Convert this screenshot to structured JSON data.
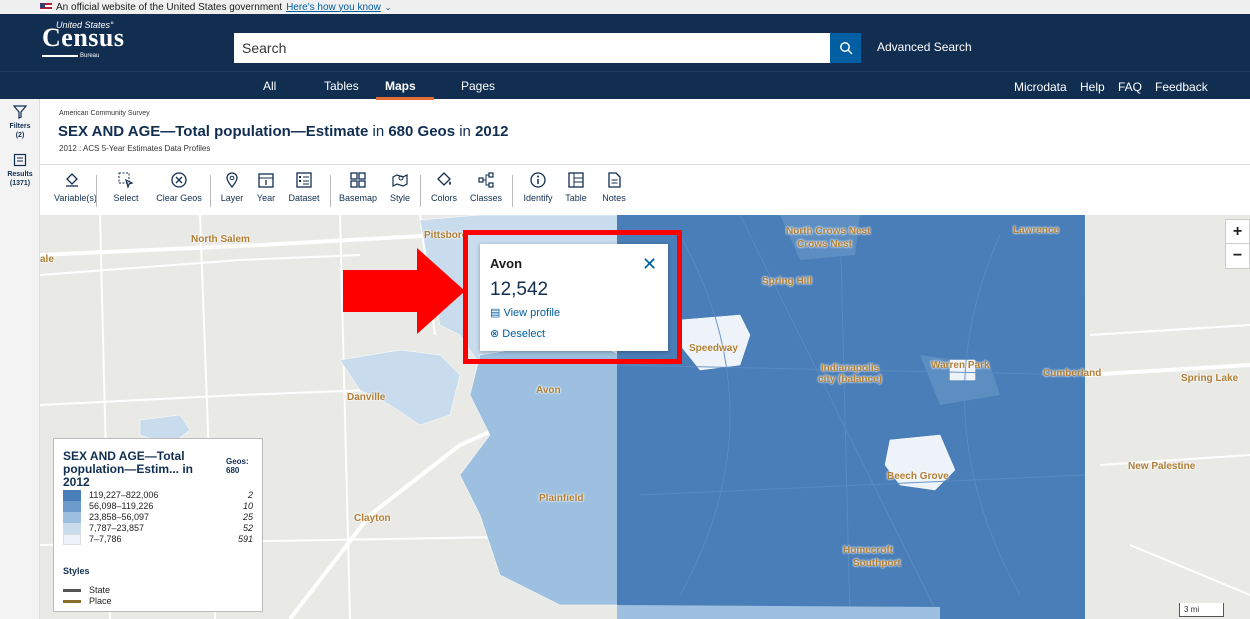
{
  "gov_banner": {
    "text": "An official website of the United States government",
    "link": "Here's how you know"
  },
  "header": {
    "logo_top": "United States°",
    "logo_main": "Census",
    "logo_bottom": "Bureau",
    "search_placeholder": "Search",
    "advanced_search": "Advanced Search"
  },
  "nav": {
    "tabs": [
      "All",
      "Tables",
      "Maps",
      "Pages"
    ],
    "active": "Maps",
    "right": [
      "Microdata",
      "Help",
      "FAQ",
      "Feedback"
    ]
  },
  "sidebar": {
    "filters_label": "Filters",
    "filters_count": "(2)",
    "results_label": "Results",
    "results_count": "(1371)"
  },
  "title_area": {
    "survey": "American Community Survey",
    "title_bold1": "SEX AND AGE—Total population—Estimate",
    "title_in1": " in ",
    "title_bold2": "680 Geos",
    "title_in2": " in ",
    "title_bold3": "2012",
    "subtitle": "2012 : ACS 5-Year Estimates Data Profiles"
  },
  "toolbar": {
    "items": [
      "Variable(s)",
      "Select",
      "Clear Geos",
      "Layer",
      "Year",
      "Dataset",
      "Basemap",
      "Style",
      "Colors",
      "Classes",
      "Identify",
      "Table",
      "Notes"
    ]
  },
  "map": {
    "labels": [
      "North Salem",
      "Pittsboro",
      "North Crows Nest",
      "Crows Nest",
      "Lawrence",
      "Spring Hill",
      "Speedway",
      "Indianapolis city (balance)",
      "Warren Park",
      "Cumberland",
      "Spring Lake",
      "Danville",
      "Avon",
      "Beech Grove",
      "New Palestine",
      "Plainfield",
      "Clayton",
      "Homecroft",
      "Southport",
      "ale"
    ],
    "scale": "3 mi"
  },
  "popup": {
    "name": "Avon",
    "value": "12,542",
    "view_profile": "View profile",
    "deselect": "Deselect"
  },
  "legend": {
    "title": "SEX AND AGE—Total population—Estim... in 2012",
    "geos_label": "Geos:",
    "geos_value": "680",
    "classes": [
      {
        "range": "119,227–822,006",
        "count": "2",
        "color": "#4a7eb8"
      },
      {
        "range": "56,098–119,226",
        "count": "10",
        "color": "#6d9bcb"
      },
      {
        "range": "23,858–56,097",
        "count": "25",
        "color": "#9dc0e0"
      },
      {
        "range": "7,787–23,857",
        "count": "52",
        "color": "#c9dcee"
      },
      {
        "range": "7–7,786",
        "count": "591",
        "color": "#eef3f9"
      }
    ],
    "styles_label": "Styles",
    "styles": [
      {
        "label": "State",
        "color": "#555555"
      },
      {
        "label": "Place",
        "color": "#8a6d2b"
      }
    ]
  }
}
